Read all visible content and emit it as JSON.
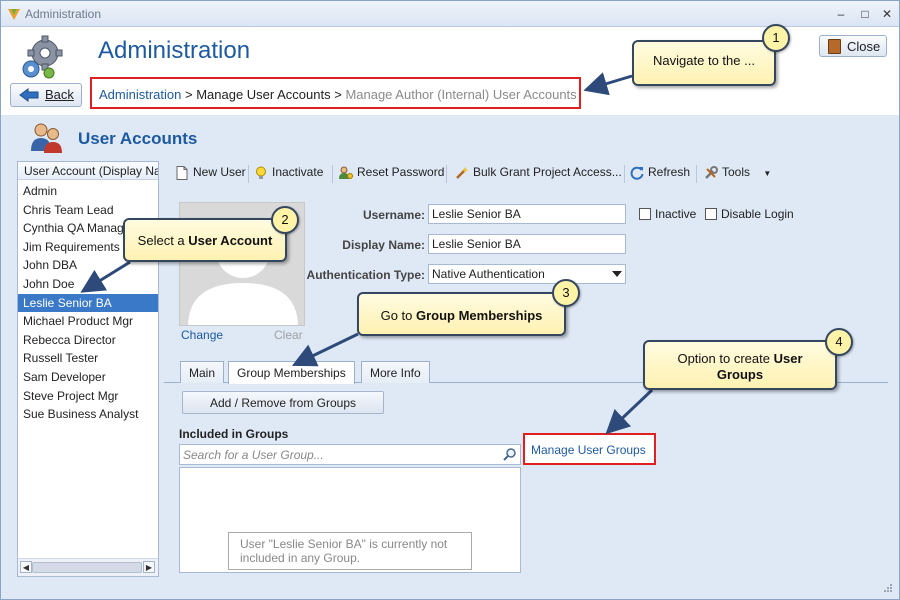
{
  "window": {
    "title": "Administration"
  },
  "header": {
    "title": "Administration",
    "back_label": "Back",
    "close_label": "Close",
    "breadcrumb": {
      "root": "Administration",
      "sep1": " > ",
      "middle": "Manage User Accounts",
      "sep2": " > ",
      "current": "Manage Author (Internal) User Accounts"
    }
  },
  "section_title": "User Accounts",
  "user_list": {
    "header": "User Account (Display Na",
    "items": [
      "Admin",
      "Chris Team Lead",
      "Cynthia QA Manag",
      "Jim Requirements",
      "John DBA",
      "John Doe",
      "Leslie Senior BA",
      "Michael Product Mgr",
      "Rebecca Director",
      "Russell Tester",
      "Sam Developer",
      "Steve Project Mgr",
      "Sue Business Analyst"
    ],
    "selected": "Leslie Senior BA"
  },
  "toolbar": {
    "new_user": "New User",
    "inactivate": "Inactivate",
    "reset_password": "Reset Password",
    "bulk_grant": "Bulk Grant Project Access...",
    "refresh": "Refresh",
    "tools": "Tools"
  },
  "photo": {
    "change": "Change",
    "clear": "Clear"
  },
  "form": {
    "username_label": "Username:",
    "username": "Leslie Senior BA",
    "display_name_label": "Display Name:",
    "display_name": "Leslie Senior BA",
    "auth_type_label": "Authentication Type:",
    "auth_type": "Native Authentication",
    "inactive_label": "Inactive",
    "disable_login_label": "Disable Login"
  },
  "tabs": [
    "Main",
    "Group Memberships",
    "More Info"
  ],
  "active_tab": "Group Memberships",
  "groups": {
    "add_remove_label": "Add / Remove from Groups",
    "included_label": "Included in Groups",
    "search_placeholder": "Search for a User Group...",
    "empty_message": "User \"Leslie Senior BA\" is currently not included in any Group.",
    "manage_link": "Manage User Groups"
  },
  "callouts": [
    {
      "number": "1",
      "text": "Navigate to the ..."
    },
    {
      "number": "2",
      "text_plain": "Select a ",
      "text_bold": "User Account"
    },
    {
      "number": "3",
      "text_plain": "Go to ",
      "text_bold": "Group Memberships"
    },
    {
      "number": "4",
      "text_plain": "Option to create ",
      "text_bold": "User Groups"
    }
  ],
  "colors": {
    "accent": "#1e5aa0",
    "highlight_border": "#e02020",
    "selection": "#3a78c8",
    "panel_bg": "#dfe9f6",
    "callout_bg": "#fff6c8"
  }
}
